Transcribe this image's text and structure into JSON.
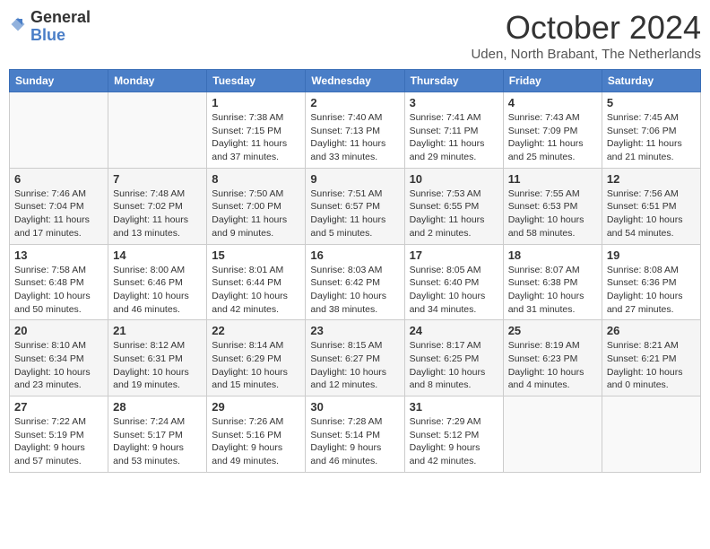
{
  "logo": {
    "general": "General",
    "blue": "Blue"
  },
  "header": {
    "month": "October 2024",
    "location": "Uden, North Brabant, The Netherlands"
  },
  "weekdays": [
    "Sunday",
    "Monday",
    "Tuesday",
    "Wednesday",
    "Thursday",
    "Friday",
    "Saturday"
  ],
  "weeks": [
    [
      {
        "day": "",
        "info": ""
      },
      {
        "day": "",
        "info": ""
      },
      {
        "day": "1",
        "info": "Sunrise: 7:38 AM\nSunset: 7:15 PM\nDaylight: 11 hours and 37 minutes."
      },
      {
        "day": "2",
        "info": "Sunrise: 7:40 AM\nSunset: 7:13 PM\nDaylight: 11 hours and 33 minutes."
      },
      {
        "day": "3",
        "info": "Sunrise: 7:41 AM\nSunset: 7:11 PM\nDaylight: 11 hours and 29 minutes."
      },
      {
        "day": "4",
        "info": "Sunrise: 7:43 AM\nSunset: 7:09 PM\nDaylight: 11 hours and 25 minutes."
      },
      {
        "day": "5",
        "info": "Sunrise: 7:45 AM\nSunset: 7:06 PM\nDaylight: 11 hours and 21 minutes."
      }
    ],
    [
      {
        "day": "6",
        "info": "Sunrise: 7:46 AM\nSunset: 7:04 PM\nDaylight: 11 hours and 17 minutes."
      },
      {
        "day": "7",
        "info": "Sunrise: 7:48 AM\nSunset: 7:02 PM\nDaylight: 11 hours and 13 minutes."
      },
      {
        "day": "8",
        "info": "Sunrise: 7:50 AM\nSunset: 7:00 PM\nDaylight: 11 hours and 9 minutes."
      },
      {
        "day": "9",
        "info": "Sunrise: 7:51 AM\nSunset: 6:57 PM\nDaylight: 11 hours and 5 minutes."
      },
      {
        "day": "10",
        "info": "Sunrise: 7:53 AM\nSunset: 6:55 PM\nDaylight: 11 hours and 2 minutes."
      },
      {
        "day": "11",
        "info": "Sunrise: 7:55 AM\nSunset: 6:53 PM\nDaylight: 10 hours and 58 minutes."
      },
      {
        "day": "12",
        "info": "Sunrise: 7:56 AM\nSunset: 6:51 PM\nDaylight: 10 hours and 54 minutes."
      }
    ],
    [
      {
        "day": "13",
        "info": "Sunrise: 7:58 AM\nSunset: 6:48 PM\nDaylight: 10 hours and 50 minutes."
      },
      {
        "day": "14",
        "info": "Sunrise: 8:00 AM\nSunset: 6:46 PM\nDaylight: 10 hours and 46 minutes."
      },
      {
        "day": "15",
        "info": "Sunrise: 8:01 AM\nSunset: 6:44 PM\nDaylight: 10 hours and 42 minutes."
      },
      {
        "day": "16",
        "info": "Sunrise: 8:03 AM\nSunset: 6:42 PM\nDaylight: 10 hours and 38 minutes."
      },
      {
        "day": "17",
        "info": "Sunrise: 8:05 AM\nSunset: 6:40 PM\nDaylight: 10 hours and 34 minutes."
      },
      {
        "day": "18",
        "info": "Sunrise: 8:07 AM\nSunset: 6:38 PM\nDaylight: 10 hours and 31 minutes."
      },
      {
        "day": "19",
        "info": "Sunrise: 8:08 AM\nSunset: 6:36 PM\nDaylight: 10 hours and 27 minutes."
      }
    ],
    [
      {
        "day": "20",
        "info": "Sunrise: 8:10 AM\nSunset: 6:34 PM\nDaylight: 10 hours and 23 minutes."
      },
      {
        "day": "21",
        "info": "Sunrise: 8:12 AM\nSunset: 6:31 PM\nDaylight: 10 hours and 19 minutes."
      },
      {
        "day": "22",
        "info": "Sunrise: 8:14 AM\nSunset: 6:29 PM\nDaylight: 10 hours and 15 minutes."
      },
      {
        "day": "23",
        "info": "Sunrise: 8:15 AM\nSunset: 6:27 PM\nDaylight: 10 hours and 12 minutes."
      },
      {
        "day": "24",
        "info": "Sunrise: 8:17 AM\nSunset: 6:25 PM\nDaylight: 10 hours and 8 minutes."
      },
      {
        "day": "25",
        "info": "Sunrise: 8:19 AM\nSunset: 6:23 PM\nDaylight: 10 hours and 4 minutes."
      },
      {
        "day": "26",
        "info": "Sunrise: 8:21 AM\nSunset: 6:21 PM\nDaylight: 10 hours and 0 minutes."
      }
    ],
    [
      {
        "day": "27",
        "info": "Sunrise: 7:22 AM\nSunset: 5:19 PM\nDaylight: 9 hours and 57 minutes."
      },
      {
        "day": "28",
        "info": "Sunrise: 7:24 AM\nSunset: 5:17 PM\nDaylight: 9 hours and 53 minutes."
      },
      {
        "day": "29",
        "info": "Sunrise: 7:26 AM\nSunset: 5:16 PM\nDaylight: 9 hours and 49 minutes."
      },
      {
        "day": "30",
        "info": "Sunrise: 7:28 AM\nSunset: 5:14 PM\nDaylight: 9 hours and 46 minutes."
      },
      {
        "day": "31",
        "info": "Sunrise: 7:29 AM\nSunset: 5:12 PM\nDaylight: 9 hours and 42 minutes."
      },
      {
        "day": "",
        "info": ""
      },
      {
        "day": "",
        "info": ""
      }
    ]
  ]
}
